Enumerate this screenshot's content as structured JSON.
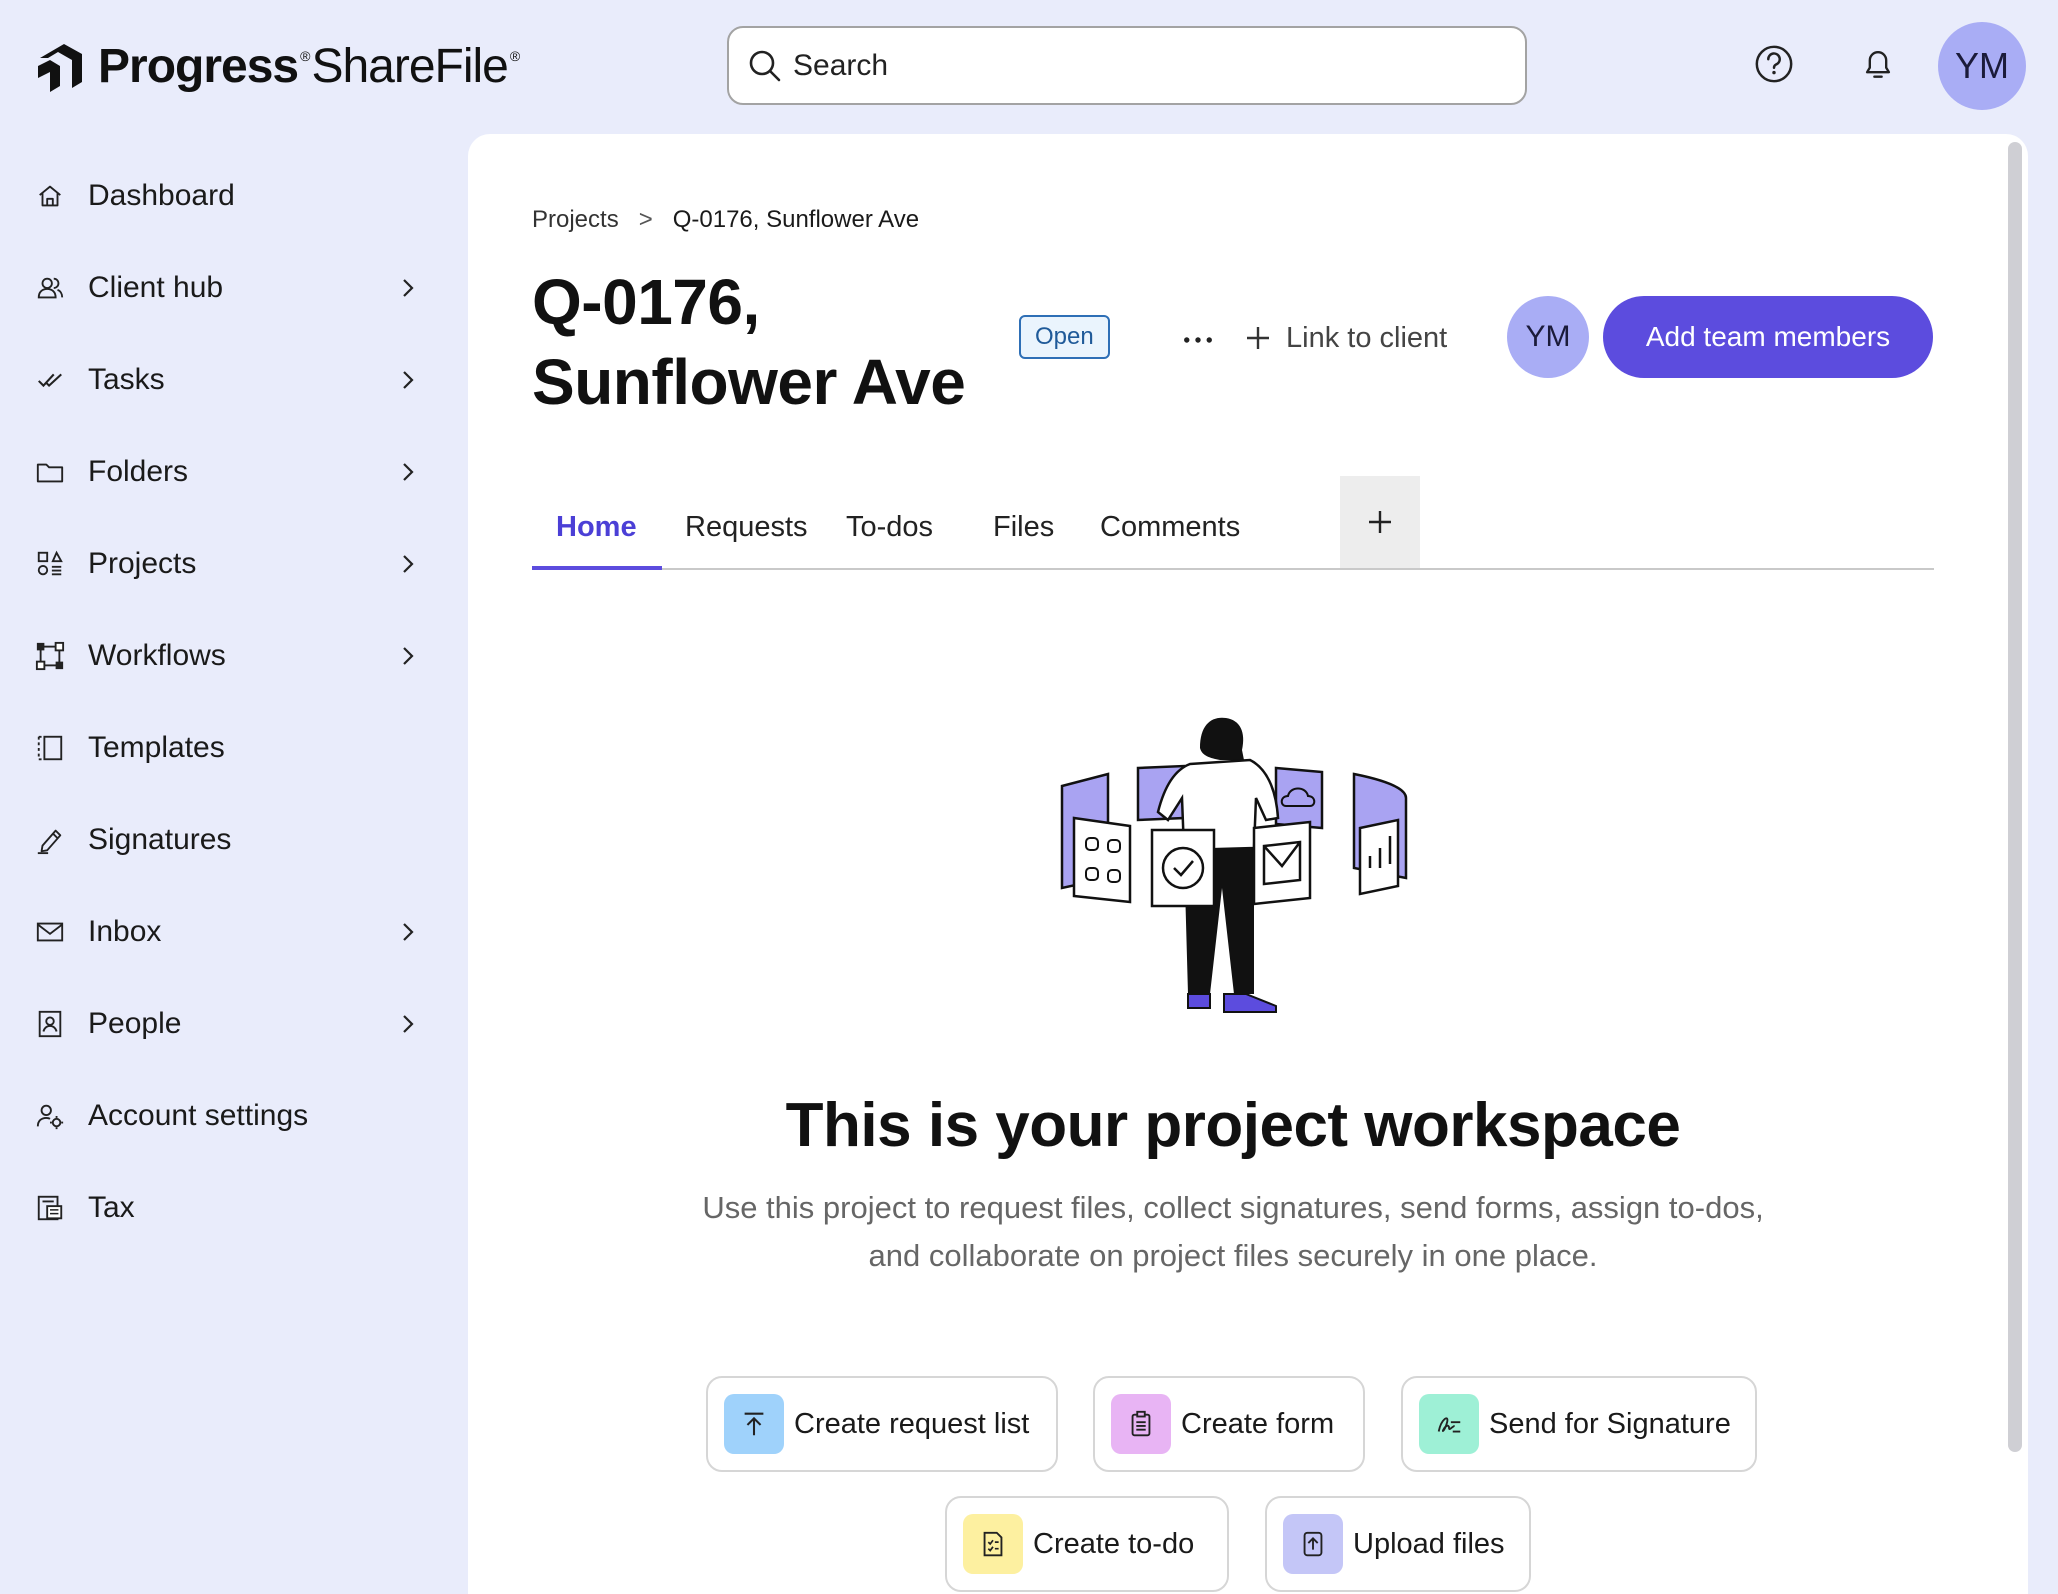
{
  "brand": {
    "name_bold": "Progress",
    "name_light": "ShareFile",
    "reg": "®"
  },
  "search": {
    "placeholder": "Search"
  },
  "user": {
    "initials": "YM"
  },
  "sidebar": {
    "items": [
      {
        "label": "Dashboard",
        "icon": "home-icon",
        "has_chevron": false
      },
      {
        "label": "Client hub",
        "icon": "client-hub-icon",
        "has_chevron": true
      },
      {
        "label": "Tasks",
        "icon": "tasks-icon",
        "has_chevron": true
      },
      {
        "label": "Folders",
        "icon": "folder-icon",
        "has_chevron": true
      },
      {
        "label": "Projects",
        "icon": "projects-icon",
        "has_chevron": true
      },
      {
        "label": "Workflows",
        "icon": "workflows-icon",
        "has_chevron": true
      },
      {
        "label": "Templates",
        "icon": "templates-icon",
        "has_chevron": false
      },
      {
        "label": "Signatures",
        "icon": "signature-pen-icon",
        "has_chevron": false
      },
      {
        "label": "Inbox",
        "icon": "inbox-icon",
        "has_chevron": true
      },
      {
        "label": "People",
        "icon": "people-icon",
        "has_chevron": true
      },
      {
        "label": "Account settings",
        "icon": "account-settings-icon",
        "has_chevron": false
      },
      {
        "label": "Tax",
        "icon": "tax-icon",
        "has_chevron": false
      }
    ]
  },
  "breadcrumb": {
    "parent": "Projects",
    "separator": ">",
    "current": "Q-0176, Sunflower Ave"
  },
  "project": {
    "title": "Q-0176, Sunflower Ave",
    "status": "Open",
    "link_client_label": "Link to client",
    "team_initials": "YM",
    "add_team_label": "Add team members"
  },
  "tabs": [
    {
      "label": "Home",
      "active": true
    },
    {
      "label": "Requests",
      "active": false
    },
    {
      "label": "To-dos",
      "active": false
    },
    {
      "label": "Files",
      "active": false
    },
    {
      "label": "Comments",
      "active": false
    }
  ],
  "workspace": {
    "title": "This is your project workspace",
    "description_line1": "Use this project to request files, collect signatures, send forms, assign to-dos,",
    "description_line2": "and collaborate on project files securely in one place."
  },
  "actions": [
    {
      "label": "Create request list",
      "icon": "upload-arrow-icon",
      "color": "#9fd2fb"
    },
    {
      "label": "Create form",
      "icon": "form-clipboard-icon",
      "color": "#e8b4f4"
    },
    {
      "label": "Send for Signature",
      "icon": "signature-icon",
      "color": "#9ef0d6"
    },
    {
      "label": "Create to-do",
      "icon": "todo-list-icon",
      "color": "#fdf0a0"
    },
    {
      "label": "Upload files",
      "icon": "upload-file-icon",
      "color": "#c4c6f7"
    }
  ],
  "colors": {
    "accent": "#5c4cde",
    "sidebar_bg": "#e9ecfb",
    "avatar": "#a9adf5",
    "status_border": "#2e6fb6"
  }
}
